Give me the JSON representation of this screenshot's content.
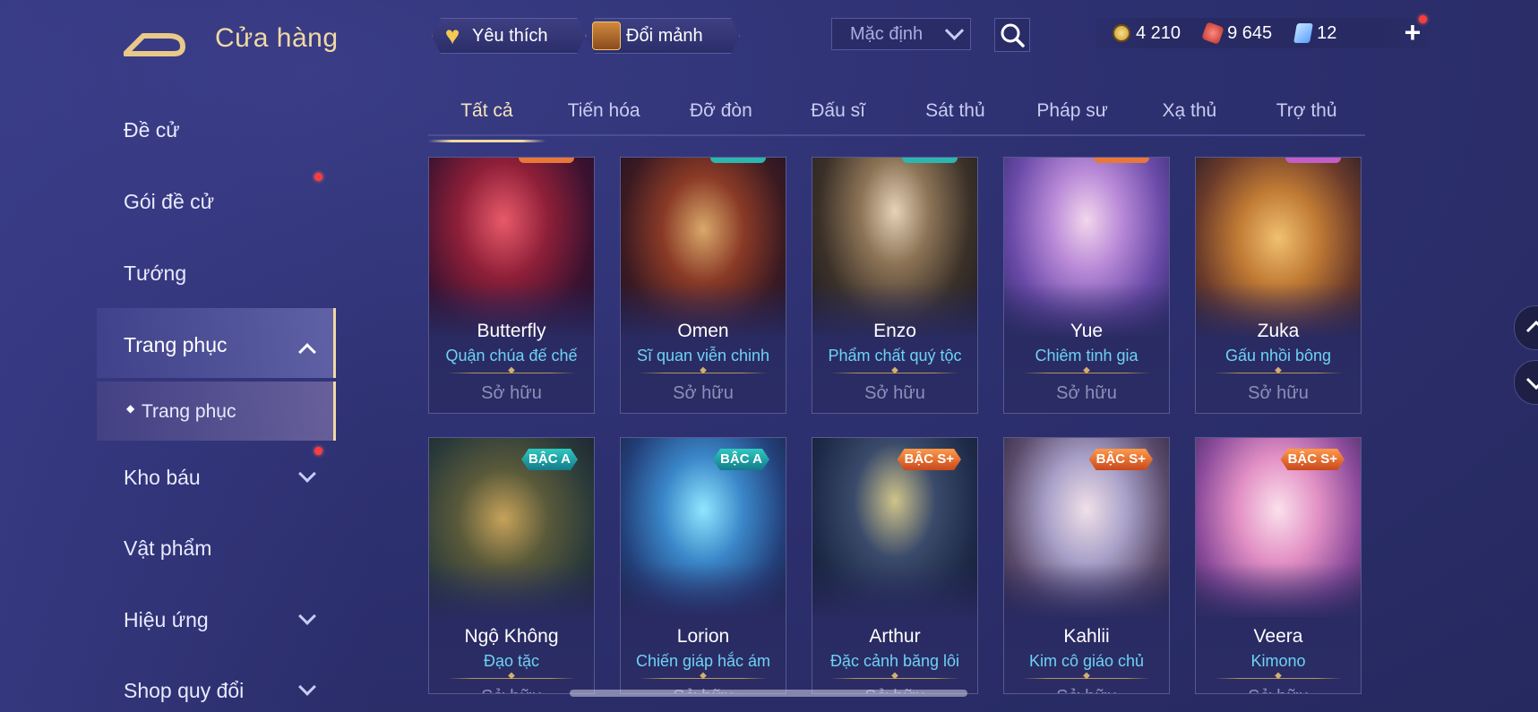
{
  "header": {
    "title": "Cửa hàng",
    "favorite_label": "Yêu thích",
    "shard_exchange_label": "Đổi mảnh",
    "sort_value": "Mặc định",
    "currencies": [
      {
        "icon": "gold-coin-icon",
        "value": "4 210"
      },
      {
        "icon": "ruby-icon",
        "value": "9 645"
      },
      {
        "icon": "voucher-icon",
        "value": "12"
      }
    ]
  },
  "sidebar": {
    "items": [
      {
        "label": "Đề cử"
      },
      {
        "label": "Gói đề cử"
      },
      {
        "label": "Tướng"
      },
      {
        "label": "Trang phục"
      },
      {
        "label": "Trang phục"
      },
      {
        "label": "Kho báu"
      },
      {
        "label": "Vật phẩm"
      },
      {
        "label": "Hiệu ứng"
      },
      {
        "label": "Shop quy đổi"
      }
    ]
  },
  "tabs": [
    "Tất cả",
    "Tiến hóa",
    "Đỡ đòn",
    "Đấu sĩ",
    "Sát thủ",
    "Pháp sư",
    "Xạ thủ",
    "Trợ thủ"
  ],
  "cards": [
    {
      "hero": "Butterfly",
      "skin": "Quận chúa đế chế",
      "status": "Sở hữu"
    },
    {
      "hero": "Omen",
      "skin": "Sĩ quan viễn chinh",
      "status": "Sở hữu"
    },
    {
      "hero": "Enzo",
      "skin": "Phẩm chất quý tộc",
      "status": "Sở hữu"
    },
    {
      "hero": "Yue",
      "skin": "Chiêm tinh gia",
      "status": "Sở hữu"
    },
    {
      "hero": "Zuka",
      "skin": "Gấu nhồi bông",
      "status": "Sở hữu"
    },
    {
      "hero": "Ngộ Không",
      "skin": "Đạo tặc",
      "status": "Sở hữu",
      "badge": "BẬC A"
    },
    {
      "hero": "Lorion",
      "skin": "Chiến giáp hắc ám",
      "status": "Sở hữu",
      "badge": "BẬC A"
    },
    {
      "hero": "Arthur",
      "skin": "Đặc cảnh băng lôi",
      "status": "Sở hữu",
      "badge": "BẬC S+"
    },
    {
      "hero": "Kahlii",
      "skin": "Kim cô giáo chủ",
      "status": "Sở hữu",
      "badge": "BẬC S+"
    },
    {
      "hero": "Veera",
      "skin": "Kimono",
      "status": "Sở hữu",
      "badge": "BẬC S+"
    }
  ]
}
